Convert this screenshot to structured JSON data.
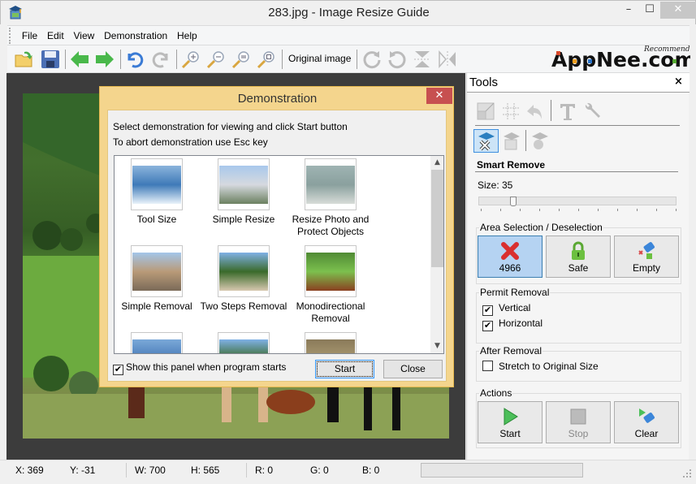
{
  "window": {
    "title": "283.jpg - Image Resize Guide",
    "controls": {
      "minimize": "–",
      "maximize": "☐",
      "close": "✕"
    }
  },
  "menu": [
    "File",
    "Edit",
    "View",
    "Demonstration",
    "Help"
  ],
  "toolbar": {
    "buttons": [
      "open-icon",
      "save-icon",
      "back-icon",
      "forward-icon",
      "undo-icon",
      "redo-icon",
      "zoom-in-icon",
      "zoom-out-icon",
      "zoom-fit-icon",
      "zoom-actual-icon"
    ],
    "original_image_label": "Original image",
    "transform_buttons": [
      "rotate-right-icon",
      "rotate-left-icon",
      "flip-vertical-icon",
      "flip-horizontal-icon"
    ],
    "logo": {
      "main": "AppNee.com",
      "tag": "Recommend"
    }
  },
  "tools_panel": {
    "title": "Tools",
    "close": "×",
    "section_title": "Smart Remove",
    "size_label": "Size: 35",
    "size_value": 35,
    "area_group": {
      "legend": "Area Selection / Deselection",
      "buttons": [
        {
          "label": "4966",
          "icon": "red-x-icon",
          "selected": true
        },
        {
          "label": "Safe",
          "icon": "padlock-icon",
          "selected": false
        },
        {
          "label": "Empty",
          "icon": "eraser-icon",
          "selected": false
        }
      ]
    },
    "permit_group": {
      "legend": "Permit Removal",
      "options": [
        {
          "label": "Vertical",
          "checked": true
        },
        {
          "label": "Horizontal",
          "checked": true
        }
      ]
    },
    "after_group": {
      "legend": "After Removal",
      "options": [
        {
          "label": "Stretch to Original Size",
          "checked": false
        }
      ]
    },
    "actions_group": {
      "legend": "Actions",
      "buttons": [
        {
          "label": "Start",
          "icon": "play-icon",
          "enabled": true
        },
        {
          "label": "Stop",
          "icon": "stop-icon",
          "enabled": false
        },
        {
          "label": "Clear",
          "icon": "clear-icon",
          "enabled": true
        }
      ]
    }
  },
  "status": {
    "x": "X: 369",
    "y": "Y: -31",
    "w": "W: 700",
    "h": "H: 565",
    "r": "R: 0",
    "g": "G: 0",
    "b": "B: 0"
  },
  "dialog": {
    "title": "Demonstration",
    "close": "✕",
    "line1": "Select demonstration for viewing and click Start button",
    "line2": "To abort demonstration use Esc key",
    "items": [
      {
        "label": "Tool Size",
        "label2": ""
      },
      {
        "label": "Simple Resize",
        "label2": ""
      },
      {
        "label": "Resize Photo and",
        "label2": "Protect Objects"
      },
      {
        "label": "Simple Removal",
        "label2": ""
      },
      {
        "label": "Two Steps Removal",
        "label2": ""
      },
      {
        "label": "Monodirectional",
        "label2": "Removal"
      },
      {
        "label": "",
        "label2": ""
      },
      {
        "label": "",
        "label2": ""
      },
      {
        "label": "",
        "label2": ""
      }
    ],
    "show_on_start": {
      "label": "Show this panel when program starts",
      "checked": true
    },
    "start_label": "Start",
    "close_label": "Close"
  }
}
